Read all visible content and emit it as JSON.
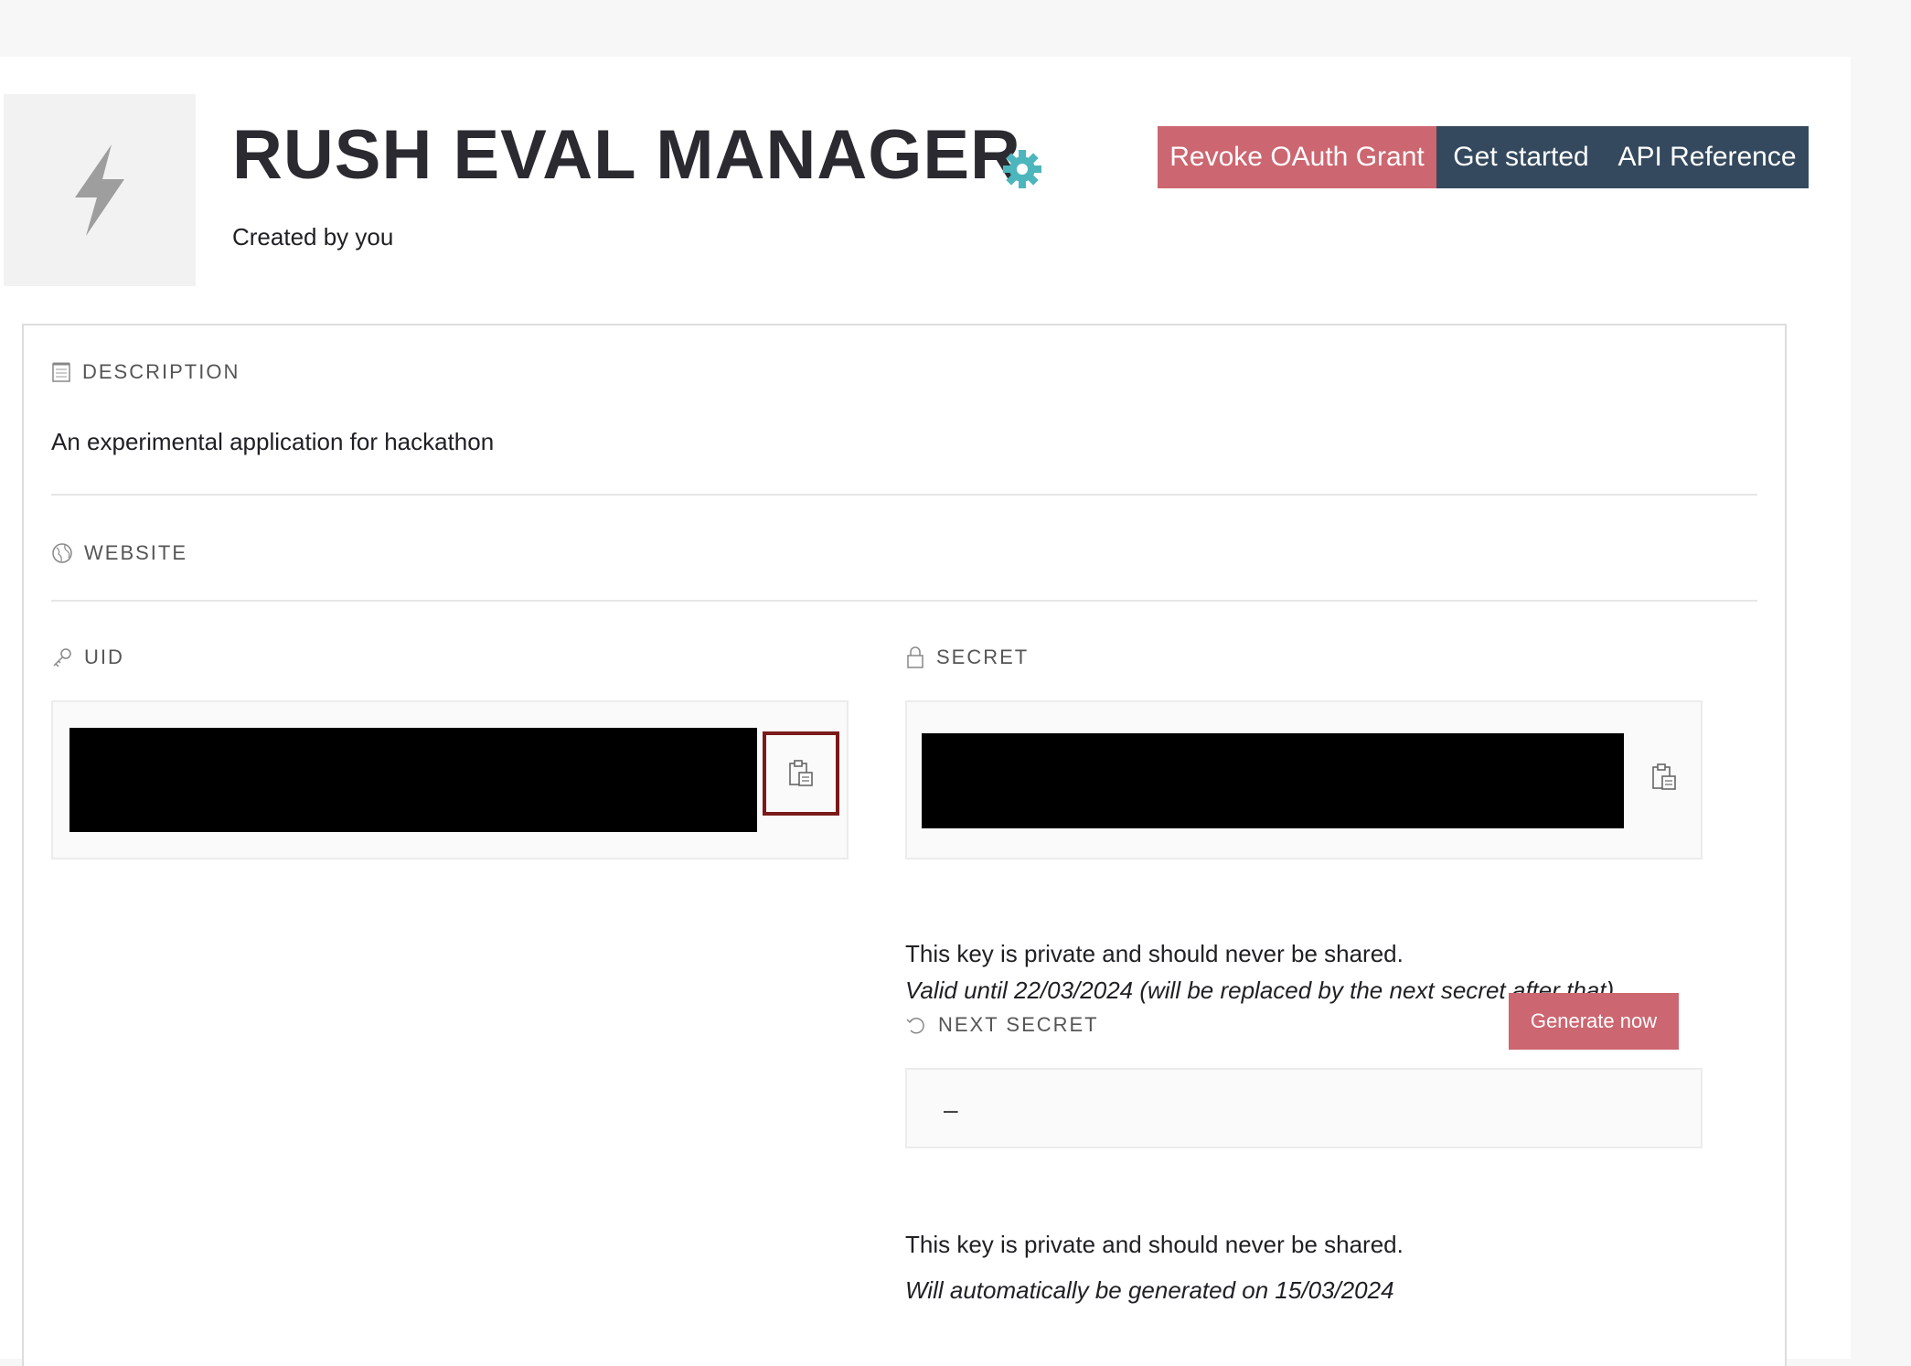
{
  "header": {
    "title": "RUSH EVAL MANAGER",
    "subtitle": "Created by you",
    "logo_icon": "lightning-bolt-icon",
    "settings_icon": "gear-icon",
    "accent_color": "#4db6bd"
  },
  "actions": {
    "revoke_label": "Revoke OAuth Grant",
    "get_started_label": "Get started",
    "api_reference_label": "API Reference",
    "revoke_color": "#cc6670",
    "dark_color": "#34495e"
  },
  "description": {
    "label": "DESCRIPTION",
    "text": "An experimental application for hackathon"
  },
  "website": {
    "label": "WEBSITE"
  },
  "uid": {
    "label": "UID"
  },
  "secret": {
    "label": "SECRET",
    "private_note": "This key is private and should never be shared.",
    "validity_note": "Valid until 22/03/2024 (will be replaced by the next secret after that)"
  },
  "next_secret": {
    "label": "NEXT SECRET",
    "value": "–",
    "private_note": "This key is private and should never be shared.",
    "schedule_note": "Will automatically be generated on 15/03/2024",
    "generate_label": "Generate now"
  }
}
